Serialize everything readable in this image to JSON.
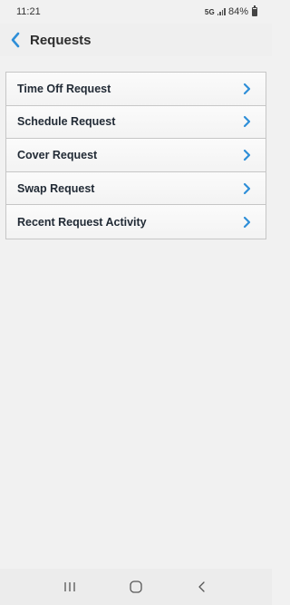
{
  "status_bar": {
    "time": "11:21",
    "network": "5G",
    "battery": "84%"
  },
  "header": {
    "title": "Requests",
    "back_icon": "chevron-left-icon",
    "accent_color": "#2f8fd8"
  },
  "requests": {
    "items": [
      {
        "label": "Time Off Request",
        "icon": "chevron-right-icon"
      },
      {
        "label": "Schedule Request",
        "icon": "chevron-right-icon"
      },
      {
        "label": "Cover Request",
        "icon": "chevron-right-icon"
      },
      {
        "label": "Swap Request",
        "icon": "chevron-right-icon"
      },
      {
        "label": "Recent Request Activity",
        "icon": "chevron-right-icon"
      }
    ]
  },
  "navigation_bar": {
    "recents_icon": "recents-icon",
    "home_icon": "home-icon",
    "back_icon": "back-icon"
  }
}
